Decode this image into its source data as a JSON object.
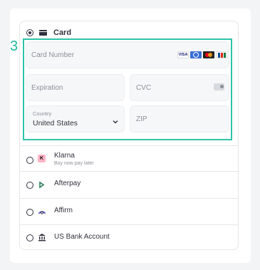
{
  "step_marker": "3",
  "card": {
    "label": "Card",
    "card_number_placeholder": "Card Number",
    "expiration_placeholder": "Expiration",
    "cvc_placeholder": "CVC",
    "country_label": "Country",
    "country_value": "United States",
    "zip_placeholder": "ZIP",
    "brands": [
      "visa-icon",
      "diners-icon",
      "mastercard-icon",
      "jcb-icon"
    ],
    "visa_text": "VISA"
  },
  "methods": [
    {
      "name": "Klarna",
      "subtitle": "Buy now pay later",
      "icon": "klarna-icon"
    },
    {
      "name": "Afterpay",
      "icon": "afterpay-icon"
    },
    {
      "name": "Affirm",
      "icon": "affirm-icon"
    },
    {
      "name": "US Bank Account",
      "icon": "bank-icon"
    }
  ],
  "colors": {
    "highlight": "#2fc3a8",
    "step": "#1fb89b",
    "klarna": "#ffb3c7"
  }
}
